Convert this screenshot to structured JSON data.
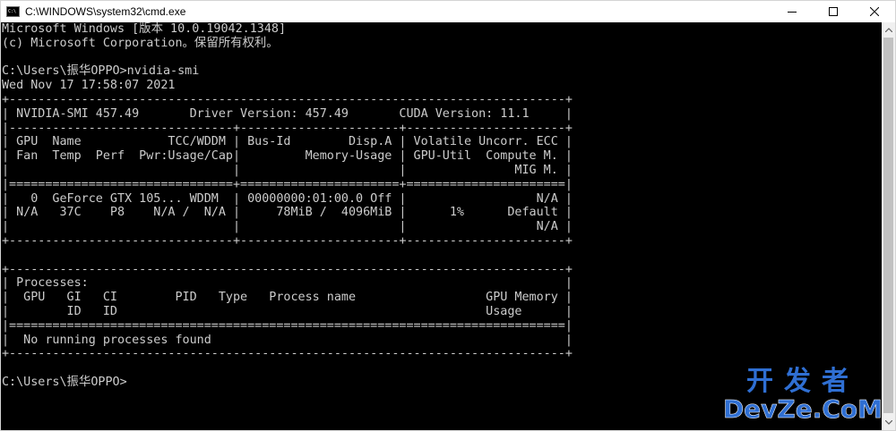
{
  "window": {
    "title": "C:\\WINDOWS\\system32\\cmd.exe"
  },
  "console": {
    "lines": [
      "Microsoft Windows [版本 10.0.19042.1348]",
      "(c) Microsoft Corporation。保留所有权利。",
      "",
      "C:\\Users\\振华OPPO>nvidia-smi",
      "Wed Nov 17 17:58:07 2021",
      "+-----------------------------------------------------------------------------+",
      "| NVIDIA-SMI 457.49       Driver Version: 457.49       CUDA Version: 11.1     |",
      "|-------------------------------+----------------------+----------------------+",
      "| GPU  Name            TCC/WDDM | Bus-Id        Disp.A | Volatile Uncorr. ECC |",
      "| Fan  Temp  Perf  Pwr:Usage/Cap|         Memory-Usage | GPU-Util  Compute M. |",
      "|                               |                      |               MIG M. |",
      "|===============================+======================+======================|",
      "|   0  GeForce GTX 105... WDDM  | 00000000:01:00.0 Off |                  N/A |",
      "| N/A   37C    P8    N/A /  N/A |     78MiB /  4096MiB |      1%      Default |",
      "|                               |                      |                  N/A |",
      "+-------------------------------+----------------------+----------------------+",
      "",
      "+-----------------------------------------------------------------------------+",
      "| Processes:                                                                  |",
      "|  GPU   GI   CI        PID   Type   Process name                  GPU Memory |",
      "|        ID   ID                                                   Usage      |",
      "|=============================================================================|",
      "|  No running processes found                                                 |",
      "+-----------------------------------------------------------------------------+",
      "",
      "C:\\Users\\振华OPPO>"
    ]
  },
  "watermark": {
    "top": "开发者",
    "bottom": "DevZe.CoM"
  },
  "icons": {
    "app": "cmd-app-icon",
    "minimize": "minimize-icon",
    "maximize": "maximize-icon",
    "close": "close-icon",
    "scroll_up": "scroll-up-arrow-icon",
    "scroll_down": "scroll-down-arrow-icon"
  },
  "colors": {
    "console_bg": "#000000",
    "console_fg": "#cccccc",
    "titlebar_bg": "#ffffff",
    "watermark": "#2f6fd3"
  }
}
